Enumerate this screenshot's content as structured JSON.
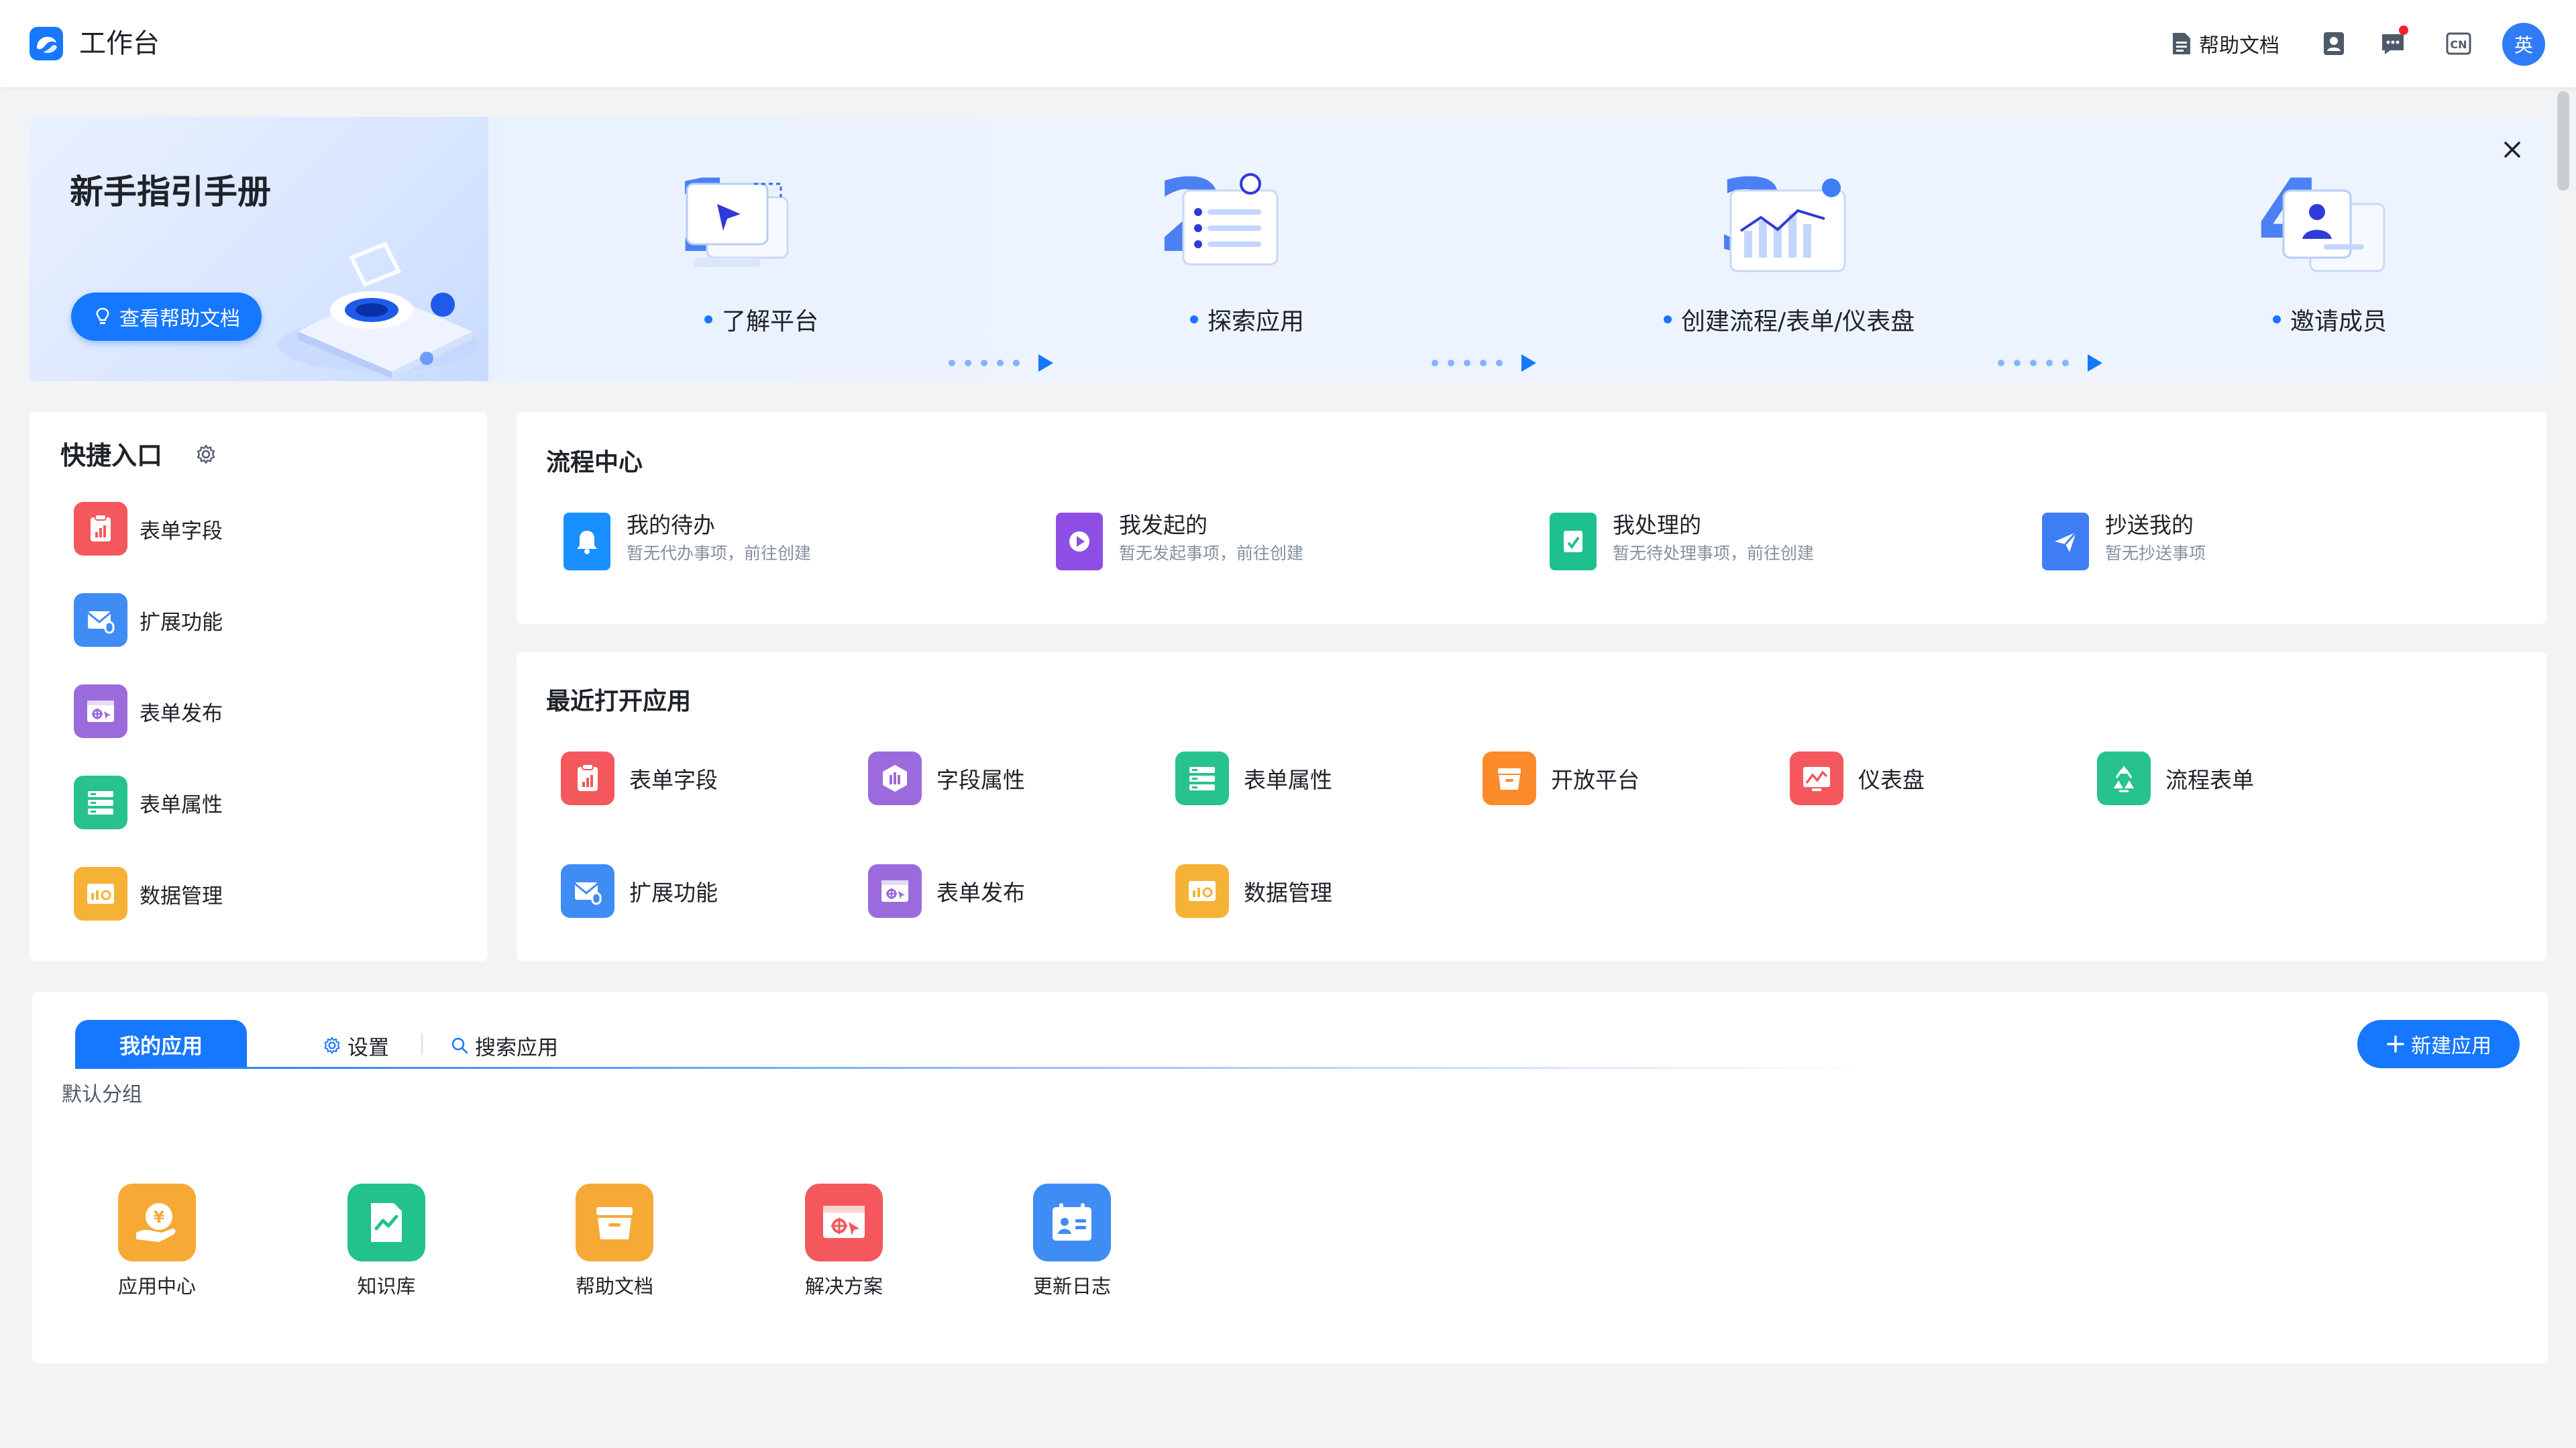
{
  "header": {
    "title": "工作台",
    "help_docs": "帮助文档",
    "language_badge": "CN",
    "avatar_text": "英"
  },
  "guide": {
    "title": "新手指引手册",
    "view_docs_button": "查看帮助文档",
    "steps": [
      {
        "number": "1",
        "label": "了解平台"
      },
      {
        "number": "2",
        "label": "探索应用"
      },
      {
        "number": "3",
        "label": "创建流程/表单/仪表盘"
      },
      {
        "number": "4",
        "label": "邀请成员"
      }
    ]
  },
  "quick_entry": {
    "title": "快捷入口",
    "items": [
      {
        "label": "表单字段",
        "icon": "form-field-icon",
        "color": "#f4585c"
      },
      {
        "label": "扩展功能",
        "icon": "extension-icon",
        "color": "#3f8cf5"
      },
      {
        "label": "表单发布",
        "icon": "form-publish-icon",
        "color": "#9b6bdd"
      },
      {
        "label": "表单属性",
        "icon": "form-property-icon",
        "color": "#27c28f"
      },
      {
        "label": "数据管理",
        "icon": "data-manage-icon",
        "color": "#f5b236"
      }
    ]
  },
  "process_center": {
    "title": "流程中心",
    "items": [
      {
        "name": "我的待办",
        "desc": "暂无代办事项，前往创建",
        "icon": "bell-icon",
        "color": "#1890ff"
      },
      {
        "name": "我发起的",
        "desc": "暂无发起事项，前往创建",
        "icon": "play-icon",
        "color": "#8e4ee6"
      },
      {
        "name": "我处理的",
        "desc": "暂无待处理事项，前往创建",
        "icon": "processed-icon",
        "color": "#1ec08d"
      },
      {
        "name": "抄送我的",
        "desc": "暂无抄送事项",
        "icon": "send-icon",
        "color": "#3f7df5"
      }
    ]
  },
  "recent_apps": {
    "title": "最近打开应用",
    "items": [
      {
        "label": "表单字段",
        "icon": "form-field-icon",
        "color": "#f4585c"
      },
      {
        "label": "字段属性",
        "icon": "field-property-icon",
        "color": "#9b6bdd"
      },
      {
        "label": "表单属性",
        "icon": "form-property-icon",
        "color": "#27c28f"
      },
      {
        "label": "开放平台",
        "icon": "open-platform-icon",
        "color": "#fb8a2b"
      },
      {
        "label": "仪表盘",
        "icon": "dashboard-icon",
        "color": "#f4585c"
      },
      {
        "label": "流程表单",
        "icon": "flow-form-icon",
        "color": "#27c28f"
      },
      {
        "label": "扩展功能",
        "icon": "extension-icon",
        "color": "#3f8cf5"
      },
      {
        "label": "表单发布",
        "icon": "form-publish-icon",
        "color": "#9b6bdd"
      },
      {
        "label": "数据管理",
        "icon": "data-manage-icon",
        "color": "#f5b236"
      }
    ]
  },
  "my_apps": {
    "tab_active": "我的应用",
    "settings": "设置",
    "search": "搜索应用",
    "new_app_button": "新建应用",
    "group_label": "默认分组",
    "apps": [
      {
        "label": "应用中心",
        "icon": "app-center-icon",
        "color": "#f7a936"
      },
      {
        "label": "知识库",
        "icon": "knowledge-base-icon",
        "color": "#22c28a"
      },
      {
        "label": "帮助文档",
        "icon": "help-docs-icon",
        "color": "#f7a936"
      },
      {
        "label": "解决方案",
        "icon": "solution-icon",
        "color": "#f4585c"
      },
      {
        "label": "更新日志",
        "icon": "changelog-icon",
        "color": "#3f8cf5"
      }
    ]
  }
}
